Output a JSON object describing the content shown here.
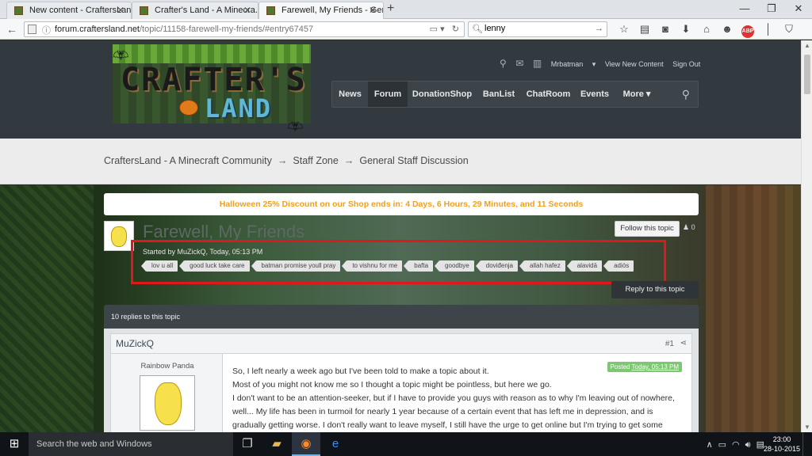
{
  "browser": {
    "tabs": [
      {
        "title": "New content - CraftersLand..."
      },
      {
        "title": "Crafter's Land - A Minecra..."
      },
      {
        "title": "Farewell, My Friends - Gen..."
      }
    ],
    "url_domain": "forum.craftersland.net",
    "url_path": "/topic/11158-farewell-my-friends/#entry67457",
    "search_value": "lenny",
    "abp_label": "ABP"
  },
  "site": {
    "logo_line1": "CRAFTER'S",
    "logo_line2": "LAND",
    "user": {
      "username": "Mrbatman",
      "view_new": "View New Content",
      "sign_out": "Sign Out"
    },
    "nav": [
      "News",
      "Forum",
      "DonationShop",
      "BanList",
      "ChatRoom",
      "Events",
      "More"
    ],
    "nav_active": "Forum"
  },
  "breadcrumbs": [
    "CraftersLand - A Minecraft Community",
    "Staff Zone",
    "General Staff Discussion"
  ],
  "promo_text": "Halloween 25% Discount on our Shop ends in: 4 Days, 6 Hours, 29 Minutes, and 11 Seconds",
  "topic": {
    "title": "Farewell, My Friends",
    "started_by": "Started by MuZickQ, Today, 05:13 PM",
    "follow_label": "Follow this topic",
    "follow_count": "0",
    "tags": [
      "lov u all",
      "good luck take care",
      "batman promise youll pray",
      "to vishnu for me",
      "bafta",
      "goodbye",
      "doviđenja",
      "allah hafez",
      "alavidā",
      "adiós"
    ],
    "reply_label": "Reply to this topic",
    "replies_label": "10 replies to this topic"
  },
  "post": {
    "author": "MuZickQ",
    "number": "#1",
    "rank": "Rainbow Panda",
    "posted_label": "Posted",
    "posted_time": "Today, 05:13 PM",
    "lines": [
      "So, I left nearly a week ago but I've been told to make a topic about it.",
      "Most of you might not know me so I thought a topic might be pointless, but here we go.",
      "I don't want to be an attention-seeker, but if I have to provide you guys with reason as to why I'm leaving out of nowhere,",
      "well... My life has been in turmoil for nearly 1 year because of a certain event that has left me in depression, and is",
      "gradually getting worse. I don't really want to leave myself, I still have the urge to get online but I'm trying to get some"
    ]
  },
  "taskbar": {
    "search_placeholder": "Search the web and Windows",
    "time": "23:00",
    "date": "28-10-2015"
  }
}
